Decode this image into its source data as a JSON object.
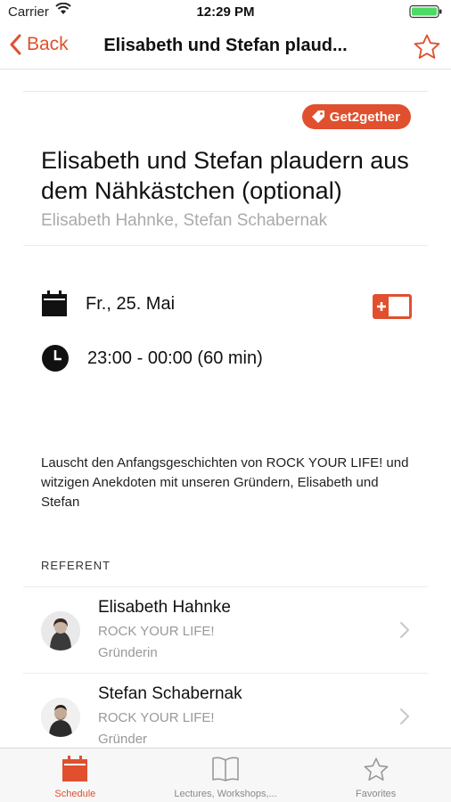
{
  "colors": {
    "accent": "#e0502e",
    "battery": "#4cd964"
  },
  "status_bar": {
    "carrier": "Carrier",
    "time": "12:29 PM"
  },
  "nav": {
    "back_label": "Back",
    "title": "Elisabeth und Stefan plaud..."
  },
  "session": {
    "badge": "Get2gether",
    "title": "Elisabeth und Stefan plaudern aus dem Nähkästchen (optional)",
    "speakers_line": "Elisabeth Hahnke, Stefan Schabernak",
    "date": "Fr., 25. Mai",
    "time": "23:00 - 00:00 (60 min)",
    "description": "Lauscht den Anfangsgeschichten von ROCK YOUR LIFE! und witzigen Anekdoten mit unseren Gründern, Elisabeth und Stefan"
  },
  "referent": {
    "label": "REFERENT",
    "speakers": [
      {
        "name": "Elisabeth Hahnke",
        "org": "ROCK YOUR LIFE!",
        "role": "Gründerin"
      },
      {
        "name": "Stefan Schabernak",
        "org": "ROCK YOUR LIFE!",
        "role": "Gründer"
      }
    ]
  },
  "tabs": [
    {
      "label": "Schedule",
      "icon": "calendar-icon",
      "active": true
    },
    {
      "label": "Lectures, Workshops,...",
      "icon": "book-icon",
      "active": false
    },
    {
      "label": "Favorites",
      "icon": "star-icon",
      "active": false
    }
  ]
}
